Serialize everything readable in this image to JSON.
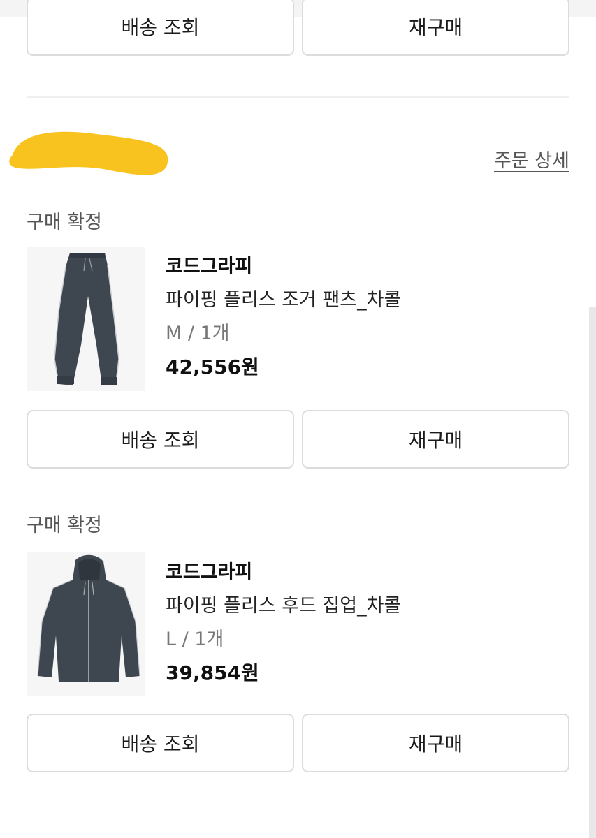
{
  "top_actions": {
    "shipping_label": "배송 조회",
    "reorder_label": "재구매"
  },
  "order": {
    "detail_link": "주문 상세",
    "items": [
      {
        "status": "구매 확정",
        "brand": "코드그라피",
        "name": "파이핑 플리스 조거 팬츠_차콜",
        "option": "M / 1개",
        "price": "42,556원",
        "image": "jogger-pants-image",
        "shipping_label": "배송 조회",
        "reorder_label": "재구매"
      },
      {
        "status": "구매 확정",
        "brand": "코드그라피",
        "name": "파이핑 플리스 후드 집업_차콜",
        "option": "L / 1개",
        "price": "39,854원",
        "image": "hood-zipup-image",
        "shipping_label": "배송 조회",
        "reorder_label": "재구매"
      }
    ]
  },
  "colors": {
    "redaction": "#f9c31f",
    "product": "#3e4650",
    "border": "#dcdcdc"
  }
}
